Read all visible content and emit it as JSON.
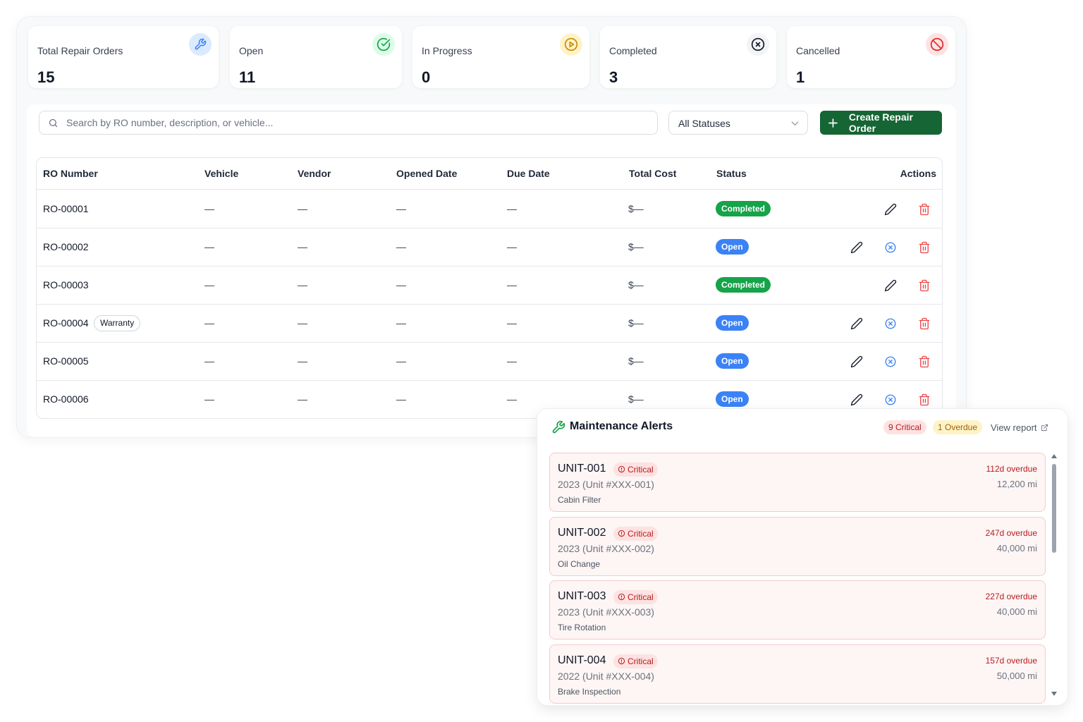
{
  "stats": [
    {
      "label": "Total Repair Orders",
      "value": "15",
      "icon": "wrench-icon",
      "icon_color": "#3b82f6",
      "icon_bg": "#dbeafe"
    },
    {
      "label": "Open",
      "value": "11",
      "icon": "check-circle-icon",
      "icon_color": "#16a34a",
      "icon_bg": "#dcfce7"
    },
    {
      "label": "In Progress",
      "value": "0",
      "icon": "play-circle-icon",
      "icon_color": "#ca8a04",
      "icon_bg": "#fef3c7"
    },
    {
      "label": "Completed",
      "value": "3",
      "icon": "x-circle-icon",
      "icon_color": "#111827",
      "icon_bg": "#f3f4f6"
    },
    {
      "label": "Cancelled",
      "value": "1",
      "icon": "ban-icon",
      "icon_color": "#dc2626",
      "icon_bg": "#fee2e2"
    }
  ],
  "toolbar": {
    "search_placeholder": "Search by RO number, description, or vehicle...",
    "status_filter": "All Statuses",
    "create_label": "Create Repair Order",
    "create_color": "#166534"
  },
  "table": {
    "headers": [
      "RO Number",
      "Vehicle",
      "Vendor",
      "Opened Date",
      "Due Date",
      "Total Cost",
      "Status",
      "Actions"
    ],
    "rows": [
      {
        "ro": "RO-00001",
        "tag": "",
        "vehicle": "—",
        "vendor": "—",
        "opened": "—",
        "due": "—",
        "cost": "$—",
        "status": "Completed"
      },
      {
        "ro": "RO-00002",
        "tag": "",
        "vehicle": "—",
        "vendor": "—",
        "opened": "—",
        "due": "—",
        "cost": "$—",
        "status": "Open"
      },
      {
        "ro": "RO-00003",
        "tag": "",
        "vehicle": "—",
        "vendor": "—",
        "opened": "—",
        "due": "—",
        "cost": "$—",
        "status": "Completed"
      },
      {
        "ro": "RO-00004",
        "tag": "Warranty",
        "vehicle": "—",
        "vendor": "—",
        "opened": "—",
        "due": "—",
        "cost": "$—",
        "status": "Open"
      },
      {
        "ro": "RO-00005",
        "tag": "",
        "vehicle": "—",
        "vendor": "—",
        "opened": "—",
        "due": "—",
        "cost": "$—",
        "status": "Open"
      },
      {
        "ro": "RO-00006",
        "tag": "",
        "vehicle": "—",
        "vendor": "—",
        "opened": "—",
        "due": "—",
        "cost": "$—",
        "status": "Open"
      }
    ],
    "status_colors": {
      "Completed": "#16a34a",
      "Open": "#3b82f6"
    }
  },
  "alerts": {
    "title": "Maintenance Alerts",
    "critical_count": "9 Critical",
    "overdue_count": "1 Overdue",
    "view_report": "View report",
    "items": [
      {
        "unit": "UNIT-001",
        "severity": "Critical",
        "vehicle": "2023 (Unit #XXX-001)",
        "service": "Cabin Filter",
        "overdue": "112d overdue",
        "miles": "12,200 mi"
      },
      {
        "unit": "UNIT-002",
        "severity": "Critical",
        "vehicle": "2023 (Unit #XXX-002)",
        "service": "Oil Change",
        "overdue": "247d overdue",
        "miles": "40,000 mi"
      },
      {
        "unit": "UNIT-003",
        "severity": "Critical",
        "vehicle": "2023 (Unit #XXX-003)",
        "service": "Tire Rotation",
        "overdue": "227d overdue",
        "miles": "40,000 mi"
      },
      {
        "unit": "UNIT-004",
        "severity": "Critical",
        "vehicle": "2022 (Unit #XXX-004)",
        "service": "Brake Inspection",
        "overdue": "157d overdue",
        "miles": "50,000 mi"
      }
    ]
  }
}
